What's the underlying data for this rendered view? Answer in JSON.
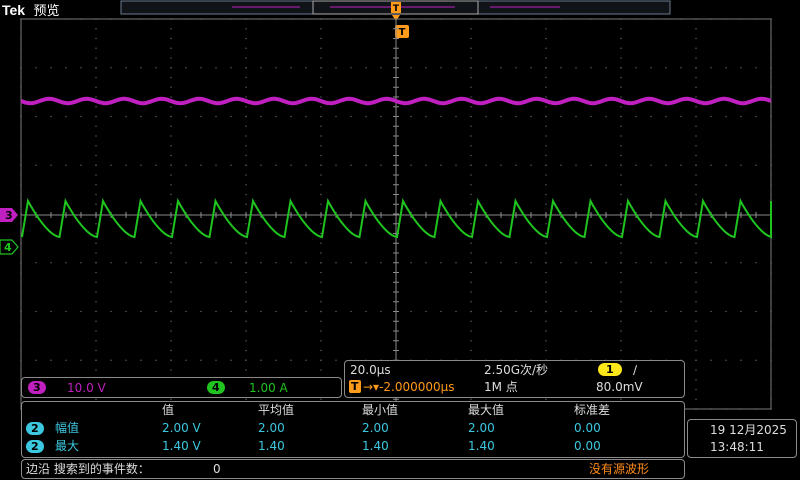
{
  "header": {
    "brand": "Tek",
    "mode": "预览"
  },
  "trigger": {
    "marker": "T",
    "source_badge": "1",
    "slope_symbol": "∕",
    "level": "80.0mV"
  },
  "channels": [
    {
      "id": "3",
      "scale": "10.0 V",
      "color": "#c020c0",
      "marker": "3"
    },
    {
      "id": "4",
      "scale": "1.00 A",
      "color": "#1fc41f",
      "marker": "4"
    }
  ],
  "timebase": {
    "scale": "20.0μs",
    "sample_rate": "2.50G次/秒",
    "position": "→▾-2.000000μs",
    "record_length": "1M 点"
  },
  "measurements": {
    "headers": [
      "值",
      "平均值",
      "最小值",
      "最大值",
      "标准差"
    ],
    "rows": [
      {
        "badge": "2",
        "name": "幅值",
        "values": [
          "2.00 V",
          "2.00",
          "2.00",
          "2.00",
          "0.00"
        ]
      },
      {
        "badge": "2",
        "name": "最大",
        "values": [
          "1.40 V",
          "1.40",
          "1.40",
          "1.40",
          "0.00"
        ]
      }
    ]
  },
  "search": {
    "label": "边沿 搜索到的事件数：",
    "count": "0",
    "status": "没有源波形"
  },
  "datetime": {
    "date": "19 12月2025",
    "time": "13:48:11"
  },
  "colors": {
    "ch3": "#c020c0",
    "ch4": "#1fc41f",
    "trigger": "#ff9a1a",
    "measure": "#3cc8e0",
    "grid": "#7a7a7a"
  }
}
